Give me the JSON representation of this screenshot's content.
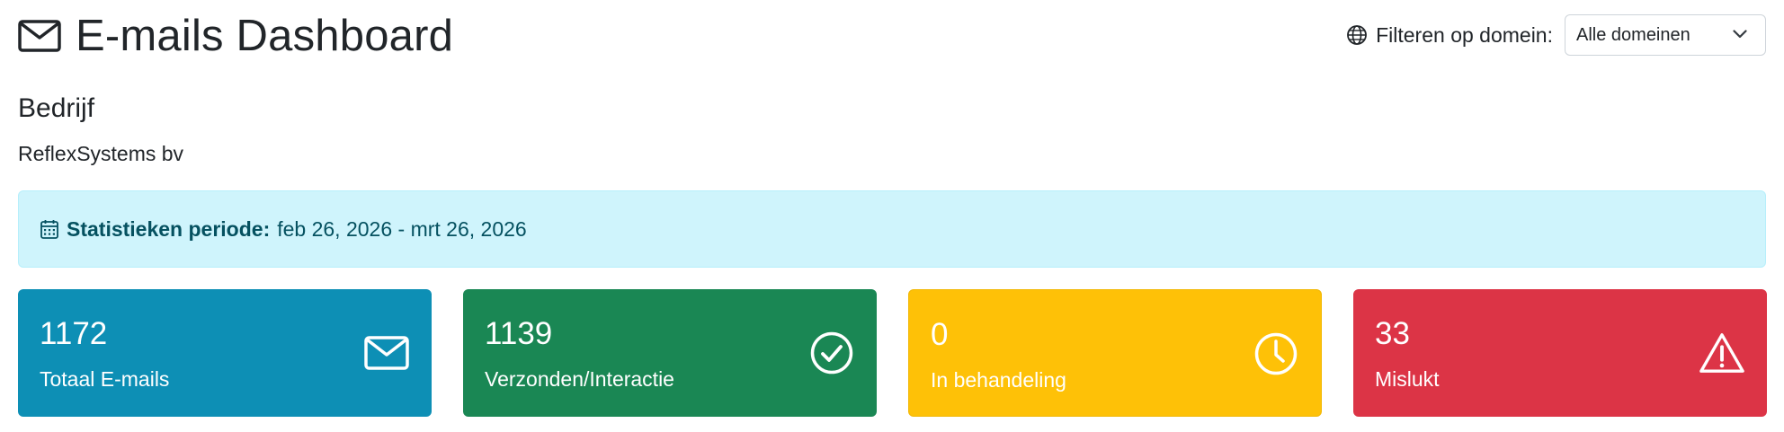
{
  "header": {
    "title": "E-mails Dashboard",
    "filter_label": "Filteren op domein:",
    "filter_selected": "Alle domeinen"
  },
  "company": {
    "heading": "Bedrijf",
    "name": "ReflexSystems bv"
  },
  "period": {
    "label": "Statistieken periode:",
    "value": "feb 26, 2026 - mrt 26, 2026"
  },
  "cards": [
    {
      "value": "1172",
      "label": "Totaal E-mails",
      "icon": "envelope-icon",
      "color": "#0d8fb5"
    },
    {
      "value": "1139",
      "label": "Verzonden/Interactie",
      "icon": "check-circle-icon",
      "color": "#1a8754"
    },
    {
      "value": "0",
      "label": "In behandeling",
      "icon": "clock-icon",
      "color": "#fec107"
    },
    {
      "value": "33",
      "label": "Mislukt",
      "icon": "warning-triangle-icon",
      "color": "#dc3446"
    }
  ]
}
